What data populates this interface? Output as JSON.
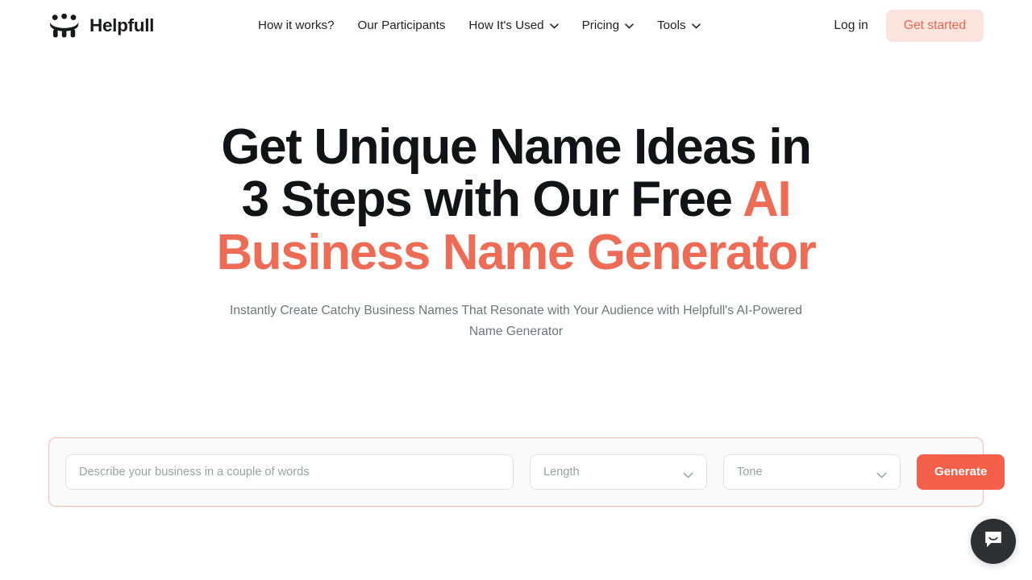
{
  "header": {
    "brand": {
      "name": "Helpfull",
      "icon": "helpfull-people-logo-icon"
    },
    "nav": [
      {
        "label": "How it works?",
        "has_dropdown": false
      },
      {
        "label": "Our Participants",
        "has_dropdown": false
      },
      {
        "label": "How It's Used",
        "has_dropdown": true,
        "icon": "chevron-down-icon"
      },
      {
        "label": "Pricing",
        "has_dropdown": true,
        "icon": "chevron-down-icon"
      },
      {
        "label": "Tools",
        "has_dropdown": true,
        "icon": "chevron-down-icon"
      }
    ],
    "login_label": "Log in",
    "get_started_label": "Get started"
  },
  "hero": {
    "headline_part1": "Get Unique Name Ideas in 3 Steps with Our Free ",
    "headline_accent": "AI Business Name Generator",
    "subtitle": "Instantly Create Catchy Business Names That Resonate with Your Audience with Helpfull's AI-Powered Name Generator"
  },
  "generator": {
    "business_input": {
      "value": "",
      "placeholder": "Describe your business in a couple of words"
    },
    "length_select": {
      "value": "Length",
      "icon": "chevron-down-icon"
    },
    "tone_select": {
      "value": "Tone",
      "icon": "chevron-down-icon"
    },
    "generate_label": "Generate"
  },
  "chat": {
    "icon": "chat-bubble-icon"
  },
  "colors": {
    "accent_coral": "#EE6B55",
    "button_coral": "#F4604A",
    "get_started_bg": "#FBE4DE",
    "form_border": "#F0BDB1",
    "form_bg": "#FAFAFA",
    "text_dark": "#121316",
    "text_muted": "#6e757c",
    "placeholder": "#9AA0A6",
    "chat_bg": "#2F3033"
  }
}
